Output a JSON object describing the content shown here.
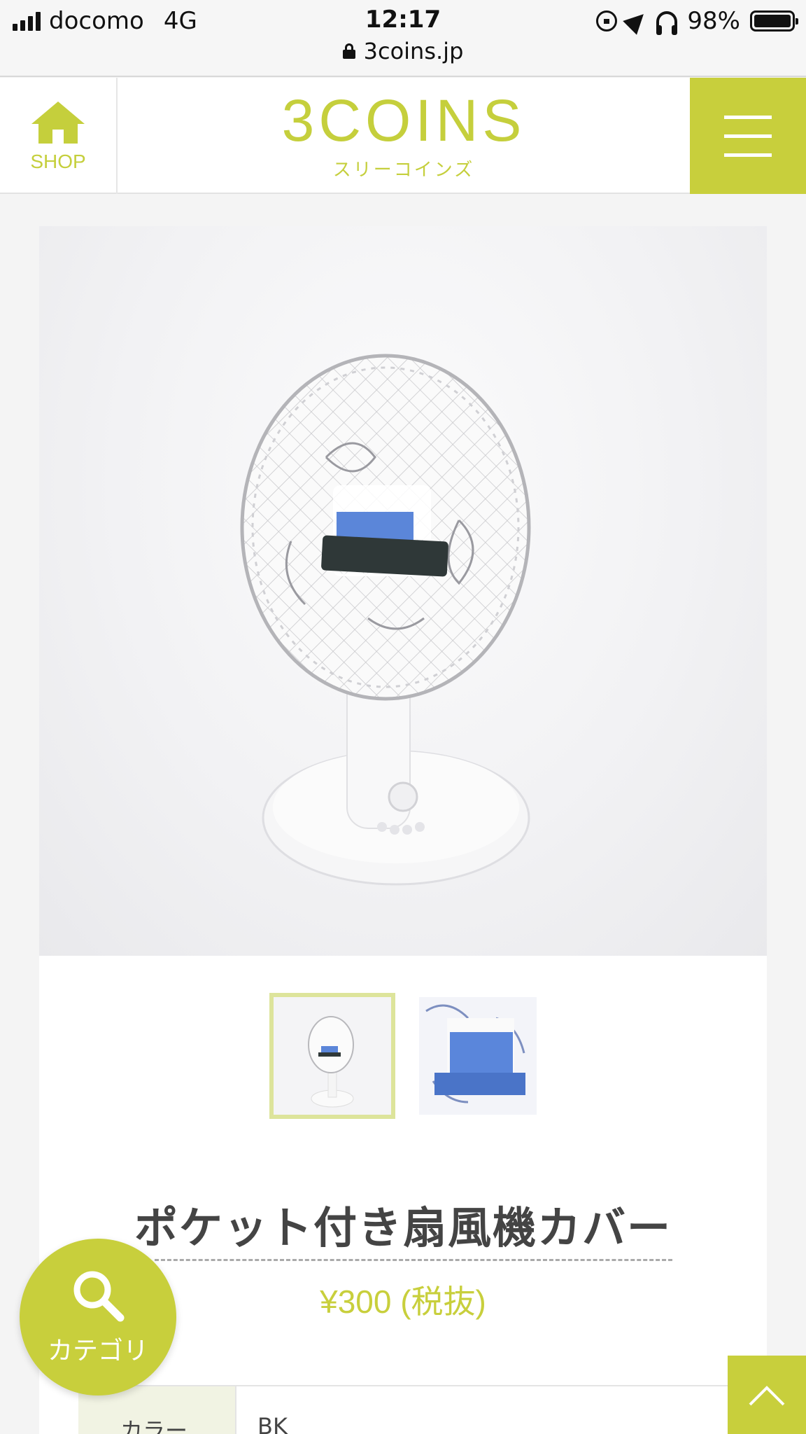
{
  "status_bar": {
    "carrier": "docomo",
    "network": "4G",
    "time": "12:17",
    "url": "3coins.jp",
    "battery": "98%"
  },
  "header": {
    "shop_label": "SHOP",
    "logo_text": "3COINS",
    "logo_kana": "スリーコインズ"
  },
  "product": {
    "title": "ポケット付き扇風機カバー",
    "price": "¥300 (税抜)",
    "specs": [
      {
        "key": "カラー",
        "value": "BK"
      }
    ]
  },
  "floating": {
    "category_label": "カテゴリ"
  },
  "colors": {
    "brand": "#c8cf3c",
    "thumb_active_border": "#dde49b"
  },
  "icons": [
    "home-icon",
    "menu-icon",
    "search-icon",
    "chevron-up-icon",
    "lock-icon",
    "battery-icon",
    "signal-icon",
    "headphones-icon",
    "location-icon",
    "rotation-lock-icon"
  ]
}
